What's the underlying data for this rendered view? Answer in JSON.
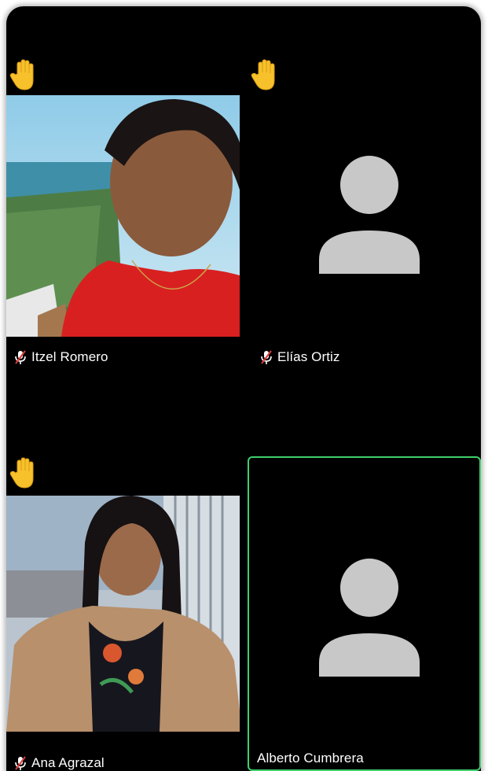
{
  "participants": [
    {
      "name": "Itzel Romero",
      "hand_raised": true,
      "muted": true,
      "video": true
    },
    {
      "name": "Elías Ortiz",
      "hand_raised": true,
      "muted": true,
      "video": false
    },
    {
      "name": "Ana Agrazal",
      "hand_raised": true,
      "muted": true,
      "video": true
    },
    {
      "name": "Alberto Cumbrera",
      "hand_raised": false,
      "muted": false,
      "video": false,
      "active_speaker": true
    }
  ],
  "icons": {
    "hand": "raised-hand-icon",
    "mic_muted": "mic-muted-icon",
    "avatar": "avatar-placeholder-icon"
  },
  "colors": {
    "background": "#000000",
    "hand_yellow": "#f7c12c",
    "mute_red": "#e03a3a",
    "active_border": "#3fcf6b",
    "avatar_gray": "#c8c8c8"
  }
}
